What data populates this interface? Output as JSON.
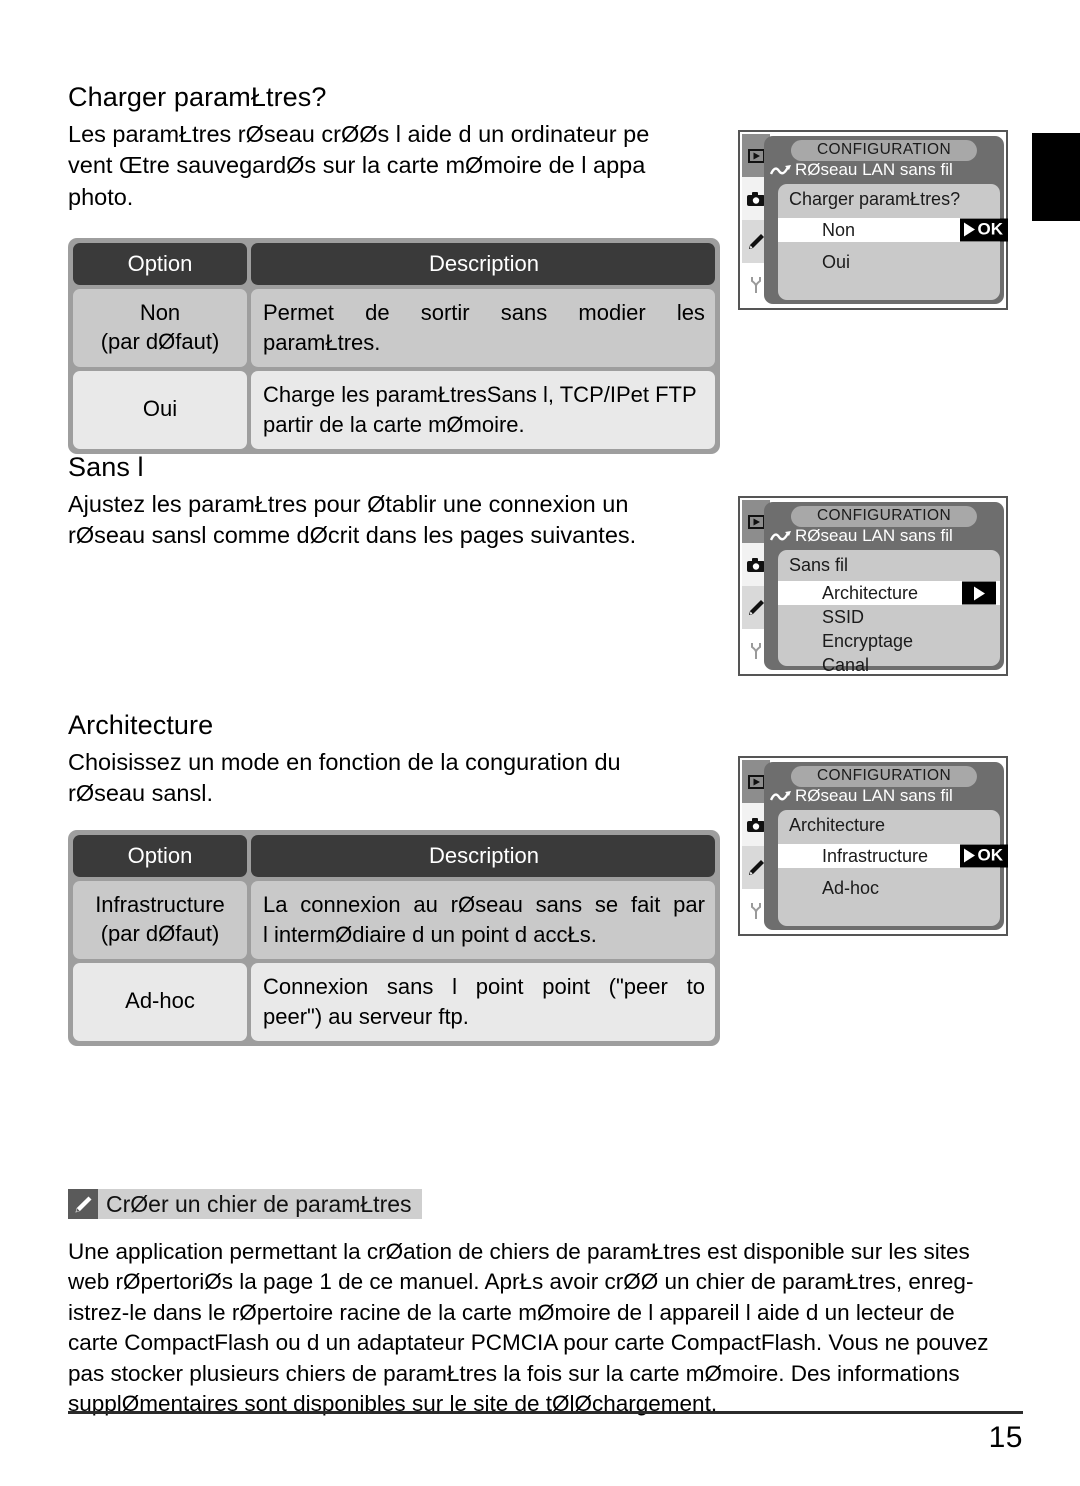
{
  "page": {
    "number": "15",
    "side_tab_color": "#000000"
  },
  "sections": [
    {
      "title": "Charger paramŁtres?",
      "lines": [
        "Les paramŁtres rØseau crØØs   l aide d un ordinateur pe",
        "vent Œtre sauvegardØs sur la carte mØmoire de l appa",
        "photo."
      ]
    },
    {
      "title": "Sans  l",
      "lines": [
        "Ajustez les paramŁtres pour Øtablir une connexion   un",
        "rØseau sansl comme dØcrit dans les pages suivantes."
      ]
    },
    {
      "title": "Architecture",
      "lines": [
        "Choisissez un mode en fonction de la conguration du",
        "rØseau sansl."
      ]
    }
  ],
  "tables": [
    {
      "headers": {
        "option": "Option",
        "description": "Description"
      },
      "rows": [
        {
          "option_line1": "Non",
          "option_line2": "(par dØfaut)",
          "desc_line1_words": [
            "Permet",
            "de",
            "sortir",
            "sans",
            "modier",
            "les"
          ],
          "desc_line2": "paramŁtres."
        },
        {
          "option_line1": "Oui",
          "option_line2": "",
          "desc_line1": "Charge les paramŁtresSans  l, TCP/IPet FTP",
          "desc_line2": " partir de la carte mØmoire."
        }
      ]
    },
    {
      "headers": {
        "option": "Option",
        "description": "Description"
      },
      "rows": [
        {
          "option_line1": "Infrastructure",
          "option_line2": "(par dØfaut)",
          "desc_line1_words": [
            "La",
            "connexion",
            "au",
            "rØseau",
            "sans",
            "se",
            "fait",
            "par"
          ],
          "desc_line2": "l intermØdiaire d un point d accŁs."
        },
        {
          "option_line1": "Ad-hoc",
          "option_line2": "",
          "desc_line1_words": [
            "Connexion",
            "sans",
            "l",
            "point",
            "point",
            "(\"peer",
            "to"
          ],
          "desc_line2": "peer\") au serveur ftp."
        }
      ]
    }
  ],
  "screens": [
    {
      "title": "CONFIGURATION",
      "subtitle": "RØseau LAN sans fil",
      "panel_head": "Charger paramŁtres?",
      "items": [
        {
          "label": "Non",
          "selected": true,
          "badge": "OK"
        },
        {
          "label": "Oui",
          "selected": false,
          "badge": ""
        }
      ]
    },
    {
      "title": "CONFIGURATION",
      "subtitle": "RØseau LAN sans fil",
      "panel_head": "Sans fil",
      "items": [
        {
          "label": "Architecture",
          "selected": true,
          "badge": ""
        },
        {
          "label": "SSID",
          "selected": false,
          "badge": ""
        },
        {
          "label": "Encryptage",
          "selected": false,
          "badge": ""
        },
        {
          "label": "Canal",
          "selected": false,
          "badge": ""
        }
      ]
    },
    {
      "title": "CONFIGURATION",
      "subtitle": "RØseau LAN sans fil",
      "panel_head": "Architecture",
      "items": [
        {
          "label": "Infrastructure",
          "selected": true,
          "badge": "OK"
        },
        {
          "label": "Ad-hoc",
          "selected": false,
          "badge": ""
        }
      ]
    }
  ],
  "note": {
    "title": "CrØer un  chier de paramŁtres",
    "lines": [
      "Une application permettant la crØation de chiers de paramŁtres est disponible sur les sites",
      "web rØpertoriØs   la page 1 de ce manuel. AprŁs avoir crØØ un  chier de paramŁtres, enreg-",
      "istrez-le dans le rØpertoire racine de la carte mØmoire de l appareil   l aide d un lecteur de",
      "carte CompactFlash ou d un adaptateur PCMCIA pour carte CompactFlash. Vous ne pouvez",
      "pas stocker plusieurs chiers de paramŁtres   la fois sur la carte mØmoire. Des informations",
      "supplØmentaires sont disponibles sur le site de tØlØchargement."
    ]
  },
  "icons": {
    "rail": [
      "play-icon",
      "camera-icon",
      "pencil-icon",
      "wrench-icon"
    ],
    "subtitle_icon": "wireless-wave-icon",
    "note_icon": "pencil-icon"
  }
}
